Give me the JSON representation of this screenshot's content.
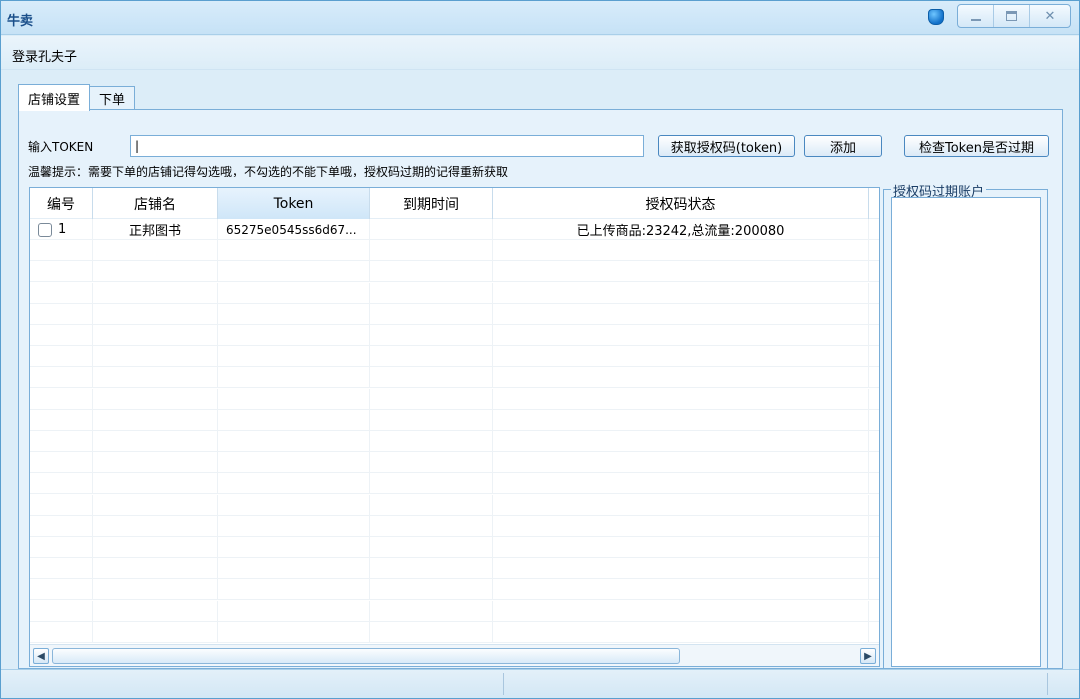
{
  "window": {
    "title": "牛卖"
  },
  "menu": {
    "items": [
      "登录孔夫子"
    ]
  },
  "tabs": [
    {
      "label": "店铺设置",
      "active": true
    },
    {
      "label": "下单",
      "active": false
    }
  ],
  "token_form": {
    "label": "输入TOKEN",
    "value": "|",
    "get_code_button": "获取授权码(token)",
    "add_button": "添加",
    "check_button": "检查Token是否过期",
    "hint": "温馨提示：需要下单的店铺记得勾选哦，不勾选的不能下单哦，授权码过期的记得重新获取"
  },
  "table": {
    "columns": [
      "编号",
      "店铺名",
      "Token",
      "到期时间",
      "授权码状态"
    ],
    "rows": [
      {
        "checked": false,
        "id": "1",
        "shop": "正邦图书",
        "token": "65275e0545ss6d67...",
        "expiry": "",
        "status": "已上传商品:23242,总流量:200080"
      }
    ]
  },
  "expired_panel": {
    "title": "授权码过期账户"
  },
  "colors": {
    "accent": "#7aaed8",
    "title_text": "#1a4f8a",
    "background": "#dcedf8"
  }
}
